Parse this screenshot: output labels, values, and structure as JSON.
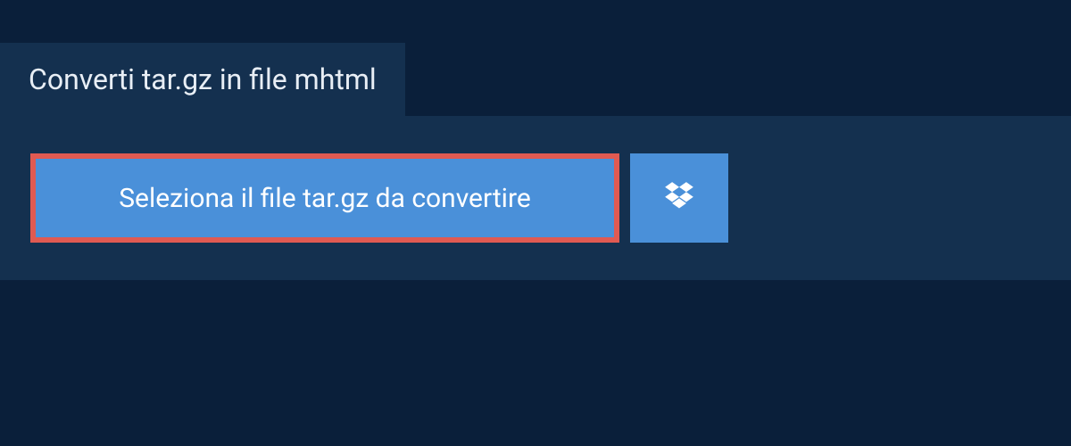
{
  "header": {
    "title": "Converti tar.gz in file mhtml"
  },
  "upload": {
    "select_label": "Seleziona il file tar.gz da convertire"
  }
}
